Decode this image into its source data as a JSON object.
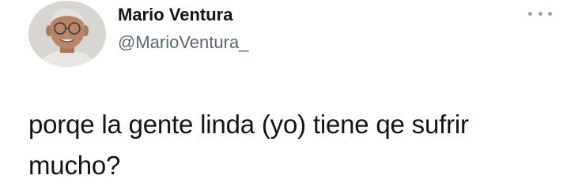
{
  "tweet": {
    "author": {
      "display_name": "Mario Ventura",
      "handle": "@MarioVentura_",
      "avatar_icon": "user-avatar-photo"
    },
    "more_icon": "more-horizontal-icon",
    "text": "porqe la gente linda (yo) tiene qe sufrir mucho?"
  },
  "colors": {
    "text_primary": "#141414",
    "text_secondary": "#5b6670",
    "icon_gray": "#9aa3ab",
    "background": "#ffffff"
  }
}
